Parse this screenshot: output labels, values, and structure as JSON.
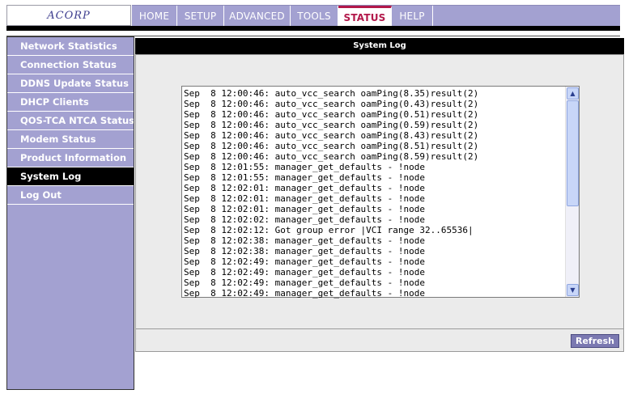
{
  "logo": {
    "text": "ACORP"
  },
  "topnav": {
    "tabs": [
      {
        "label": "HOME",
        "active": false
      },
      {
        "label": "SETUP",
        "active": false
      },
      {
        "label": "ADVANCED",
        "active": false
      },
      {
        "label": "TOOLS",
        "active": false
      },
      {
        "label": "STATUS",
        "active": true
      },
      {
        "label": "HELP",
        "active": false
      }
    ]
  },
  "sidebar": {
    "items": [
      {
        "label": "Network Statistics",
        "active": false
      },
      {
        "label": "Connection Status",
        "active": false
      },
      {
        "label": "DDNS Update Status",
        "active": false
      },
      {
        "label": "DHCP Clients",
        "active": false
      },
      {
        "label": "QOS-TCA NTCA Status",
        "active": false
      },
      {
        "label": "Modem Status",
        "active": false
      },
      {
        "label": "Product Information",
        "active": false
      },
      {
        "label": "System Log",
        "active": true
      },
      {
        "label": "Log Out",
        "active": false
      }
    ]
  },
  "main": {
    "title": "System Log",
    "log_lines": [
      "Sep  8 12:00:46: auto_vcc_search oamPing(8.35)result(2)",
      "Sep  8 12:00:46: auto_vcc_search oamPing(0.43)result(2)",
      "Sep  8 12:00:46: auto_vcc_search oamPing(0.51)result(2)",
      "Sep  8 12:00:46: auto_vcc_search oamPing(0.59)result(2)",
      "Sep  8 12:00:46: auto_vcc_search oamPing(8.43)result(2)",
      "Sep  8 12:00:46: auto_vcc_search oamPing(8.51)result(2)",
      "Sep  8 12:00:46: auto_vcc_search oamPing(8.59)result(2)",
      "Sep  8 12:01:55: manager_get_defaults - !node",
      "Sep  8 12:01:55: manager_get_defaults - !node",
      "Sep  8 12:02:01: manager_get_defaults - !node",
      "Sep  8 12:02:01: manager_get_defaults - !node",
      "Sep  8 12:02:01: manager_get_defaults - !node",
      "Sep  8 12:02:02: manager_get_defaults - !node",
      "Sep  8 12:02:12: Got group error |VCI range 32..65536|",
      "Sep  8 12:02:38: manager_get_defaults - !node",
      "Sep  8 12:02:38: manager_get_defaults - !node",
      "Sep  8 12:02:49: manager_get_defaults - !node",
      "Sep  8 12:02:49: manager_get_defaults - !node",
      "Sep  8 12:02:49: manager_get_defaults - !node",
      "Sep  8 12:02:49: manager_get_defaults - !node"
    ],
    "refresh_label": "Refresh"
  },
  "colors": {
    "nav_background": "#a3a1d1",
    "active_tab_text": "#b2184a",
    "header_black": "#000000",
    "button_background": "#7b79b1"
  }
}
